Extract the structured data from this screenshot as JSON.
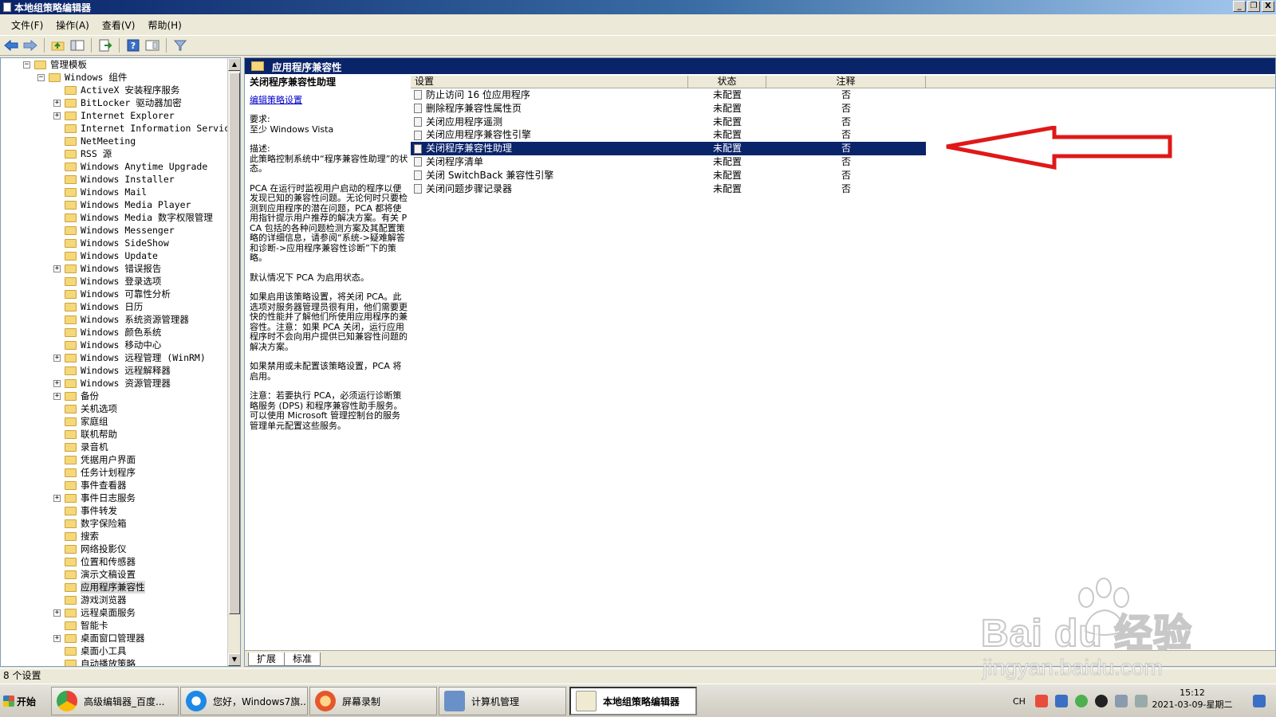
{
  "window": {
    "title": "本地组策略编辑器",
    "controls": [
      "_",
      "❐",
      "X"
    ]
  },
  "menu": [
    "文件(F)",
    "操作(A)",
    "查看(V)",
    "帮助(H)"
  ],
  "tree": {
    "items": [
      {
        "label": "管理模板",
        "level": 0,
        "expander": "−"
      },
      {
        "label": "Windows 组件",
        "level": 1,
        "expander": "−"
      },
      {
        "label": "ActiveX 安装程序服务",
        "level": 2,
        "expander": ""
      },
      {
        "label": "BitLocker 驱动器加密",
        "level": 2,
        "expander": "+"
      },
      {
        "label": "Internet Explorer",
        "level": 2,
        "expander": "+"
      },
      {
        "label": "Internet Information Services",
        "level": 2,
        "expander": ""
      },
      {
        "label": "NetMeeting",
        "level": 2,
        "expander": ""
      },
      {
        "label": "RSS 源",
        "level": 2,
        "expander": ""
      },
      {
        "label": "Windows Anytime Upgrade",
        "level": 2,
        "expander": ""
      },
      {
        "label": "Windows Installer",
        "level": 2,
        "expander": ""
      },
      {
        "label": "Windows Mail",
        "level": 2,
        "expander": ""
      },
      {
        "label": "Windows Media Player",
        "level": 2,
        "expander": ""
      },
      {
        "label": "Windows Media 数字权限管理",
        "level": 2,
        "expander": ""
      },
      {
        "label": "Windows Messenger",
        "level": 2,
        "expander": ""
      },
      {
        "label": "Windows SideShow",
        "level": 2,
        "expander": ""
      },
      {
        "label": "Windows Update",
        "level": 2,
        "expander": ""
      },
      {
        "label": "Windows 错误报告",
        "level": 2,
        "expander": "+"
      },
      {
        "label": "Windows 登录选项",
        "level": 2,
        "expander": ""
      },
      {
        "label": "Windows 可靠性分析",
        "level": 2,
        "expander": ""
      },
      {
        "label": "Windows 日历",
        "level": 2,
        "expander": ""
      },
      {
        "label": "Windows 系统资源管理器",
        "level": 2,
        "expander": ""
      },
      {
        "label": "Windows 颜色系统",
        "level": 2,
        "expander": ""
      },
      {
        "label": "Windows 移动中心",
        "level": 2,
        "expander": ""
      },
      {
        "label": "Windows 远程管理 (WinRM)",
        "level": 2,
        "expander": "+"
      },
      {
        "label": "Windows 远程解释器",
        "level": 2,
        "expander": ""
      },
      {
        "label": "Windows 资源管理器",
        "level": 2,
        "expander": "+"
      },
      {
        "label": "备份",
        "level": 2,
        "expander": "+"
      },
      {
        "label": "关机选项",
        "level": 2,
        "expander": ""
      },
      {
        "label": "家庭组",
        "level": 2,
        "expander": ""
      },
      {
        "label": "联机帮助",
        "level": 2,
        "expander": ""
      },
      {
        "label": "录音机",
        "level": 2,
        "expander": ""
      },
      {
        "label": "凭据用户界面",
        "level": 2,
        "expander": ""
      },
      {
        "label": "任务计划程序",
        "level": 2,
        "expander": ""
      },
      {
        "label": "事件查看器",
        "level": 2,
        "expander": ""
      },
      {
        "label": "事件日志服务",
        "level": 2,
        "expander": "+"
      },
      {
        "label": "事件转发",
        "level": 2,
        "expander": ""
      },
      {
        "label": "数字保险箱",
        "level": 2,
        "expander": ""
      },
      {
        "label": "搜索",
        "level": 2,
        "expander": ""
      },
      {
        "label": "网络投影仪",
        "level": 2,
        "expander": ""
      },
      {
        "label": "位置和传感器",
        "level": 2,
        "expander": ""
      },
      {
        "label": "演示文稿设置",
        "level": 2,
        "expander": ""
      },
      {
        "label": "应用程序兼容性",
        "level": 2,
        "expander": "",
        "selected": true
      },
      {
        "label": "游戏浏览器",
        "level": 2,
        "expander": ""
      },
      {
        "label": "远程桌面服务",
        "level": 2,
        "expander": "+"
      },
      {
        "label": "智能卡",
        "level": 2,
        "expander": ""
      },
      {
        "label": "桌面窗口管理器",
        "level": 2,
        "expander": "+"
      },
      {
        "label": "桌面小工具",
        "level": 2,
        "expander": ""
      },
      {
        "label": "自动播放策略",
        "level": 2,
        "expander": ""
      }
    ]
  },
  "pane": {
    "header": "应用程序兼容性",
    "desc_title": "关闭程序兼容性助理",
    "edit_link": "编辑策略设置",
    "requirement": "要求:\n至少 Windows Vista",
    "description_label": "描述:\n此策略控制系统中“程序兼容性助理”的状态。",
    "para1": "PCA 在运行时监视用户启动的程序以便发现已知的兼容性问题。无论何时只要检测到应用程序的潜在问题，PCA 都将使用指针提示用户推荐的解决方案。有关 PCA 包括的各种问题检测方案及其配置策略的详细信息，请参阅“系统->疑难解答和诊断->应用程序兼容性诊断”下的策略。",
    "para2": "默认情况下 PCA 为启用状态。",
    "para3": "如果启用该策略设置，将关闭 PCA。此选项对服务器管理员很有用，他们需要更快的性能并了解他们所使用应用程序的兼容性。注意：如果 PCA 关闭，运行应用程序时不会向用户提供已知兼容性问题的解决方案。",
    "para4": "如果禁用或未配置该策略设置，PCA 将启用。",
    "para5": "注意：若要执行 PCA，必须运行诊断策略服务 (DPS) 和程序兼容性助手服务。可以使用 Microsoft 管理控制台的服务管理单元配置这些服务。"
  },
  "list": {
    "headers": {
      "setting": "设置",
      "state": "状态",
      "comment": "注释"
    },
    "rows": [
      {
        "setting": "防止访问 16 位应用程序",
        "state": "未配置",
        "comment": "否"
      },
      {
        "setting": "删除程序兼容性属性页",
        "state": "未配置",
        "comment": "否"
      },
      {
        "setting": "关闭应用程序遥测",
        "state": "未配置",
        "comment": "否"
      },
      {
        "setting": "关闭应用程序兼容性引擎",
        "state": "未配置",
        "comment": "否"
      },
      {
        "setting": "关闭程序兼容性助理",
        "state": "未配置",
        "comment": "否",
        "selected": true
      },
      {
        "setting": "关闭程序清单",
        "state": "未配置",
        "comment": "否"
      },
      {
        "setting": "关闭 SwitchBack 兼容性引擎",
        "state": "未配置",
        "comment": "否"
      },
      {
        "setting": "关闭问题步骤记录器",
        "state": "未配置",
        "comment": "否"
      }
    ]
  },
  "tabs": [
    "扩展",
    "标准"
  ],
  "status": "8 个设置",
  "taskbar": {
    "start": "开始",
    "tasks": [
      "高级编辑器_百度...",
      "您好，Windows7旗...",
      "屏幕录制",
      "计算机管理",
      "本地组策略编辑器"
    ],
    "lang": "CH",
    "time": "15:12",
    "date": "2021-03-09-星期二"
  },
  "watermark": {
    "brand": "Bai du 经验",
    "url": "jingyan.baidu.com"
  },
  "colors": {
    "selection": "#0a246a",
    "arrow": "#e01818",
    "folder": "#f6d77a"
  }
}
